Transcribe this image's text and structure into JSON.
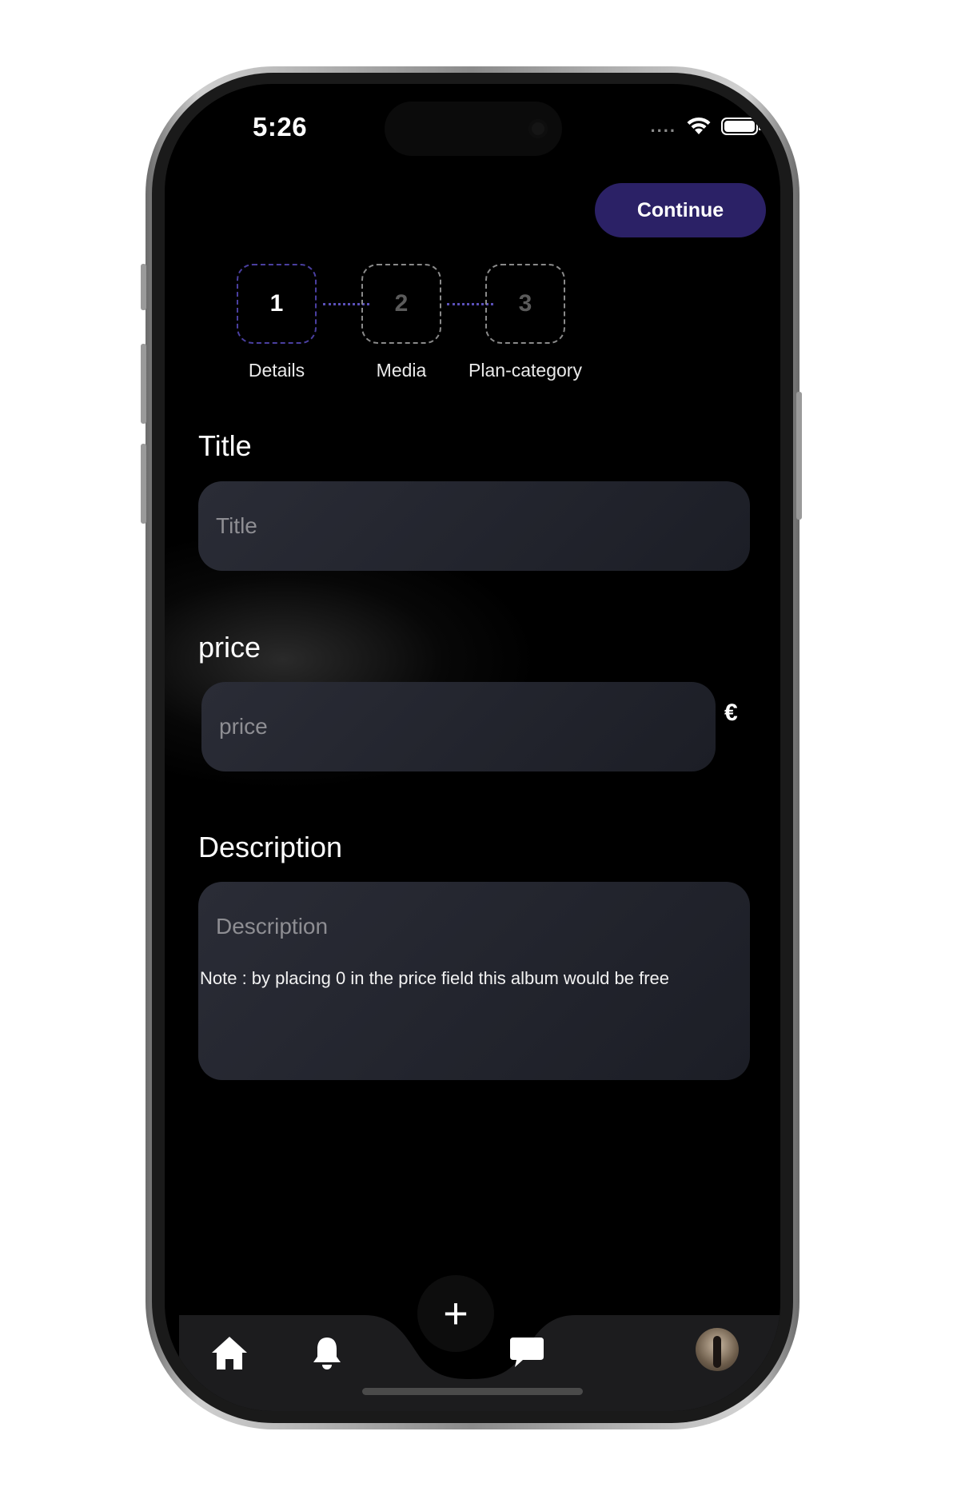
{
  "status_bar": {
    "time": "5:26",
    "signal": "...."
  },
  "header": {
    "continue_label": "Continue"
  },
  "stepper": {
    "steps": [
      {
        "number": "1",
        "label": "Details",
        "active": true
      },
      {
        "number": "2",
        "label": "Media",
        "active": false
      },
      {
        "number": "3",
        "label": "Plan-category",
        "active": false
      }
    ]
  },
  "form": {
    "title": {
      "label": "Title",
      "placeholder": "Title",
      "value": ""
    },
    "price": {
      "label": "price",
      "placeholder": "price",
      "value": "",
      "currency": "€"
    },
    "description": {
      "label": "Description",
      "placeholder": "Description",
      "value": ""
    },
    "note": "Note : by placing 0 in the price field this album would be free"
  },
  "tabbar": {
    "items": [
      {
        "icon": "home-icon"
      },
      {
        "icon": "bell-icon"
      },
      {
        "icon": "plus-icon",
        "glyph": "+"
      },
      {
        "icon": "chat-icon"
      },
      {
        "icon": "avatar"
      }
    ]
  },
  "colors": {
    "accent": "#2b2166",
    "background": "#000000",
    "field": "#23252e"
  }
}
